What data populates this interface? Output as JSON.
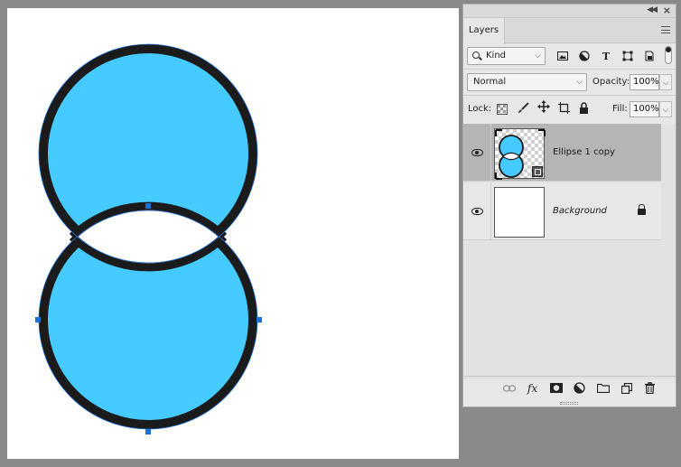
{
  "layers_panel": {
    "tab_label": "Layers",
    "filter": {
      "kind_label": "Kind",
      "icons": [
        "image-filter-icon",
        "adjustment-filter-icon",
        "type-filter-icon",
        "shape-filter-icon",
        "smart-object-filter-icon"
      ],
      "type_glyph": "T"
    },
    "blend_mode": "Normal",
    "opacity_label": "Opacity:",
    "opacity_value": "100%",
    "lock_label": "Lock:",
    "fill_label": "Fill:",
    "fill_value": "100%",
    "layers": [
      {
        "name": "Ellipse 1 copy",
        "selected": true,
        "visible": true
      },
      {
        "name": "Background",
        "selected": false,
        "visible": true,
        "locked": true
      }
    ],
    "bottom_icons": [
      "link-layers-icon",
      "fx-icon",
      "layer-mask-icon",
      "adjustment-layer-icon",
      "group-folder-icon",
      "new-layer-icon",
      "delete-layer-icon"
    ],
    "fx_glyph": "fx"
  },
  "canvas": {
    "shape_fill": "#45cbff",
    "shape_stroke": "#1b1b1b",
    "selection_color": "#1e6fd6"
  }
}
